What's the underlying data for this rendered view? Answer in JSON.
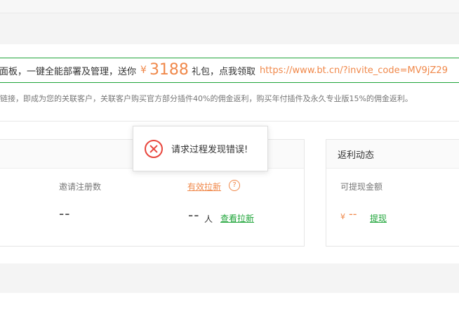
{
  "promo": {
    "prefix": "面板，一键全能部署及管理，送你",
    "currency": "¥",
    "amount": "3188",
    "suffix": "礼包，点我领取",
    "link": "https://www.bt.cn/?invite_code=MV9jZ29"
  },
  "note": "链接，即成为您的关联客户，关联客户购买官方部分插件40%的佣金返利，购买年付插件及永久专业版15%的佣金返利。",
  "stats_card": {
    "invited_label": "邀请注册数",
    "invited_value": "--",
    "effective_label": "有效拉新",
    "help_icon_glyph": "?",
    "effective_value": "--",
    "effective_unit": "人",
    "view_link": "查看拉新"
  },
  "rebate_card": {
    "title": "返利动态",
    "withdrawable_label": "可提现金额",
    "currency": "¥",
    "amount": "--",
    "withdraw_link": "提现"
  },
  "toast": {
    "message": "请求过程发现错误!",
    "icon": "error-circle-x-icon"
  },
  "colors": {
    "accent_orange": "#f0884a",
    "accent_green": "#20a53a",
    "error_red": "#e8453c"
  }
}
